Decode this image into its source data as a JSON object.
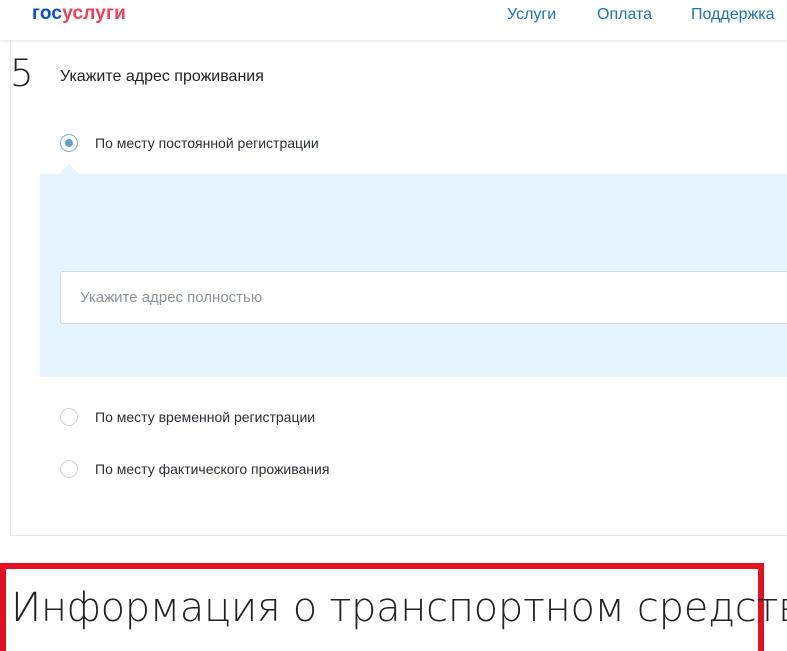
{
  "header": {
    "logo_part1": "гос",
    "logo_part2": "услуги",
    "nav": {
      "services": "Услуги",
      "payment": "Оплата",
      "support": "Поддержка"
    }
  },
  "step": {
    "number": "5",
    "title": "Укажите адрес проживания",
    "options": [
      {
        "label": "По месту постоянной регистрации",
        "selected": true
      },
      {
        "label": "По месту временной регистрации",
        "selected": false
      },
      {
        "label": "По месту фактического проживания",
        "selected": false
      }
    ],
    "address_input": {
      "placeholder": "Укажите адрес полностью",
      "value": ""
    }
  },
  "next_section": {
    "title": "Информация о транспортном средстве"
  },
  "colors": {
    "brand_blue": "#0d4cd3",
    "brand_red": "#ee3f58",
    "nav_link": "#1a73b8",
    "panel_background": "#e6f4fd",
    "radio_selected": "#5ea5cc",
    "highlight_frame": "#e3111f"
  }
}
